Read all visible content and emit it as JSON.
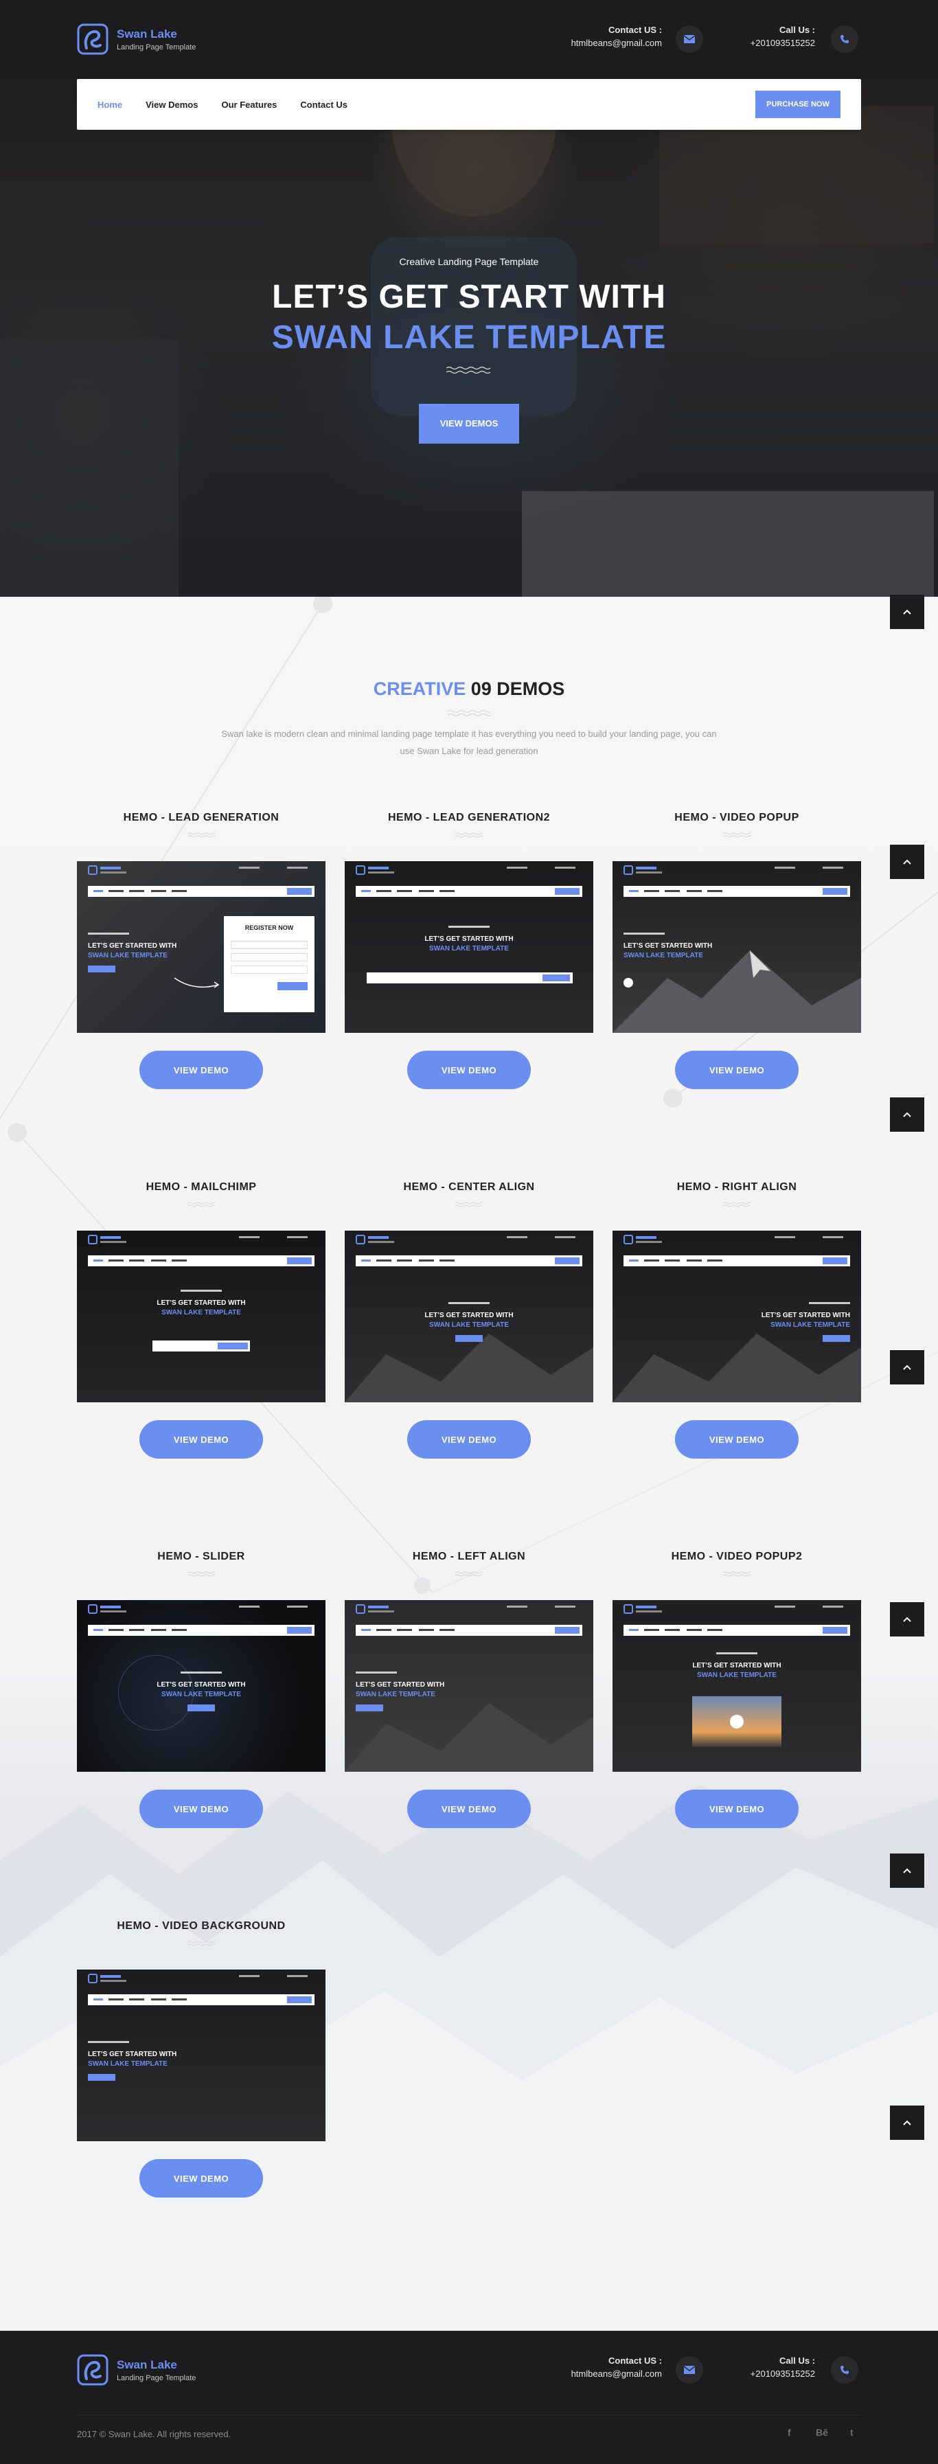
{
  "header": {
    "logo_title": "Swan Lake",
    "logo_subtitle": "Landing Page Template",
    "contact_email_label": "Contact US :",
    "contact_email": "htmlbeans@gmail.com",
    "contact_phone_label": "Call Us :",
    "contact_phone": "+201093515252"
  },
  "nav": {
    "items": [
      "Home",
      "View Demos",
      "Our Features",
      "Contact Us"
    ],
    "active": "Home",
    "purchase_label": "PURCHASE NOW"
  },
  "hero": {
    "small_title": "Creative Landing Page Template",
    "line1": "LET’S GET START WITH",
    "line2": "SWAN LAKE TEMPLATE",
    "button_label": "VIEW DEMOS"
  },
  "demos_section": {
    "title_accent": "CREATIVE",
    "title_rest": " 09 DEMOS",
    "description": "Swan lake is modern clean and minimal landing page template it has everything you need to build your landing page, you can use Swan Lake for lead generation",
    "items": [
      {
        "title": "HEMO - LEAD GENERATION",
        "button": "VIEW DEMO"
      },
      {
        "title": "HEMO - LEAD GENERATION2",
        "button": "VIEW DEMO"
      },
      {
        "title": "HEMO - VIDEO POPUP",
        "button": "VIEW DEMO"
      },
      {
        "title": "HEMO - MAILCHIMP",
        "button": "VIEW DEMO"
      },
      {
        "title": "HEMO - CENTER ALIGN",
        "button": "VIEW DEMO"
      },
      {
        "title": "HEMO - RIGHT ALIGN",
        "button": "VIEW DEMO"
      },
      {
        "title": "HEMO - SLIDER",
        "button": "VIEW DEMO"
      },
      {
        "title": "HEMO - LEFT ALIGN",
        "button": "VIEW DEMO"
      },
      {
        "title": "HEMO - VIDEO POPUP2",
        "button": "VIEW DEMO"
      },
      {
        "title": "HEMO - VIDEO BACKGROUND",
        "button": "VIEW DEMO"
      }
    ],
    "preview_line1": "LET’S GET STARTED WITH",
    "preview_line2": "SWAN LAKE TEMPLATE",
    "preview_form_title": "REGISTER NOW"
  },
  "footer": {
    "logo_title": "Swan Lake",
    "logo_subtitle": "Landing Page Template",
    "contact_email_label": "Contact US :",
    "contact_email": "htmlbeans@gmail.com",
    "contact_phone_label": "Call Us :",
    "contact_phone": "+201093515252",
    "copyright": "2017 © Swan Lake. All rights reserved.",
    "social": [
      "f",
      "Bē",
      "t"
    ]
  },
  "colors": {
    "accent": "#6b8ff0",
    "dark": "#1c1c1e"
  },
  "icons": {
    "email": "envelope-icon",
    "phone": "phone-icon",
    "to_top": "chevron-up-icon"
  }
}
